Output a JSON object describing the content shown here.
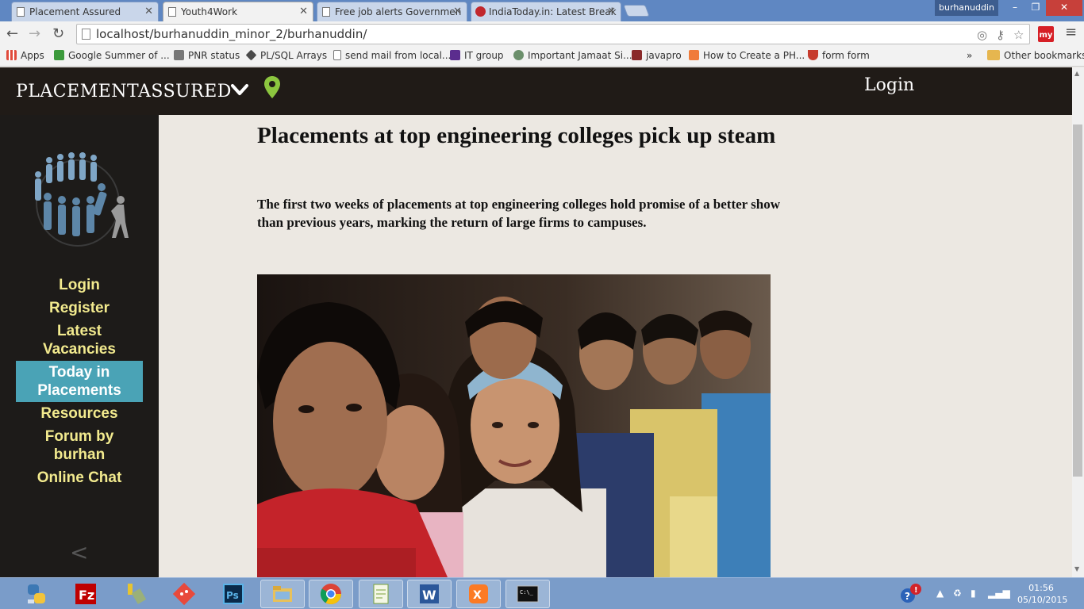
{
  "browser": {
    "tabs": [
      {
        "title": "Placement Assured",
        "active": false
      },
      {
        "title": "Youth4Work",
        "active": true
      },
      {
        "title": "Free job alerts Governmen",
        "active": false
      },
      {
        "title": "IndiaToday.in: Latest Break",
        "active": false
      }
    ],
    "profile": "burhanuddin",
    "url": "localhost/burhanuddin_minor_2/burhanuddin/",
    "extension_label": "my",
    "bookmarks": [
      {
        "label": "Apps",
        "color": "#e04a3b"
      },
      {
        "label": "Google Summer of ...",
        "color": "#3c9a3c"
      },
      {
        "label": "PNR status",
        "color": "#777777"
      },
      {
        "label": "PL/SQL Arrays",
        "color": "#4a4a4a"
      },
      {
        "label": "send mail from local...",
        "color": "#ffffff"
      },
      {
        "label": "IT group",
        "color": "#5b2d8e"
      },
      {
        "label": "Important Jamaat Si...",
        "color": "#6b8f6b"
      },
      {
        "label": "javapro",
        "color": "#8a2a2a"
      },
      {
        "label": "How to Create a PH...",
        "color": "#f07b3a"
      },
      {
        "label": "form form",
        "color": "#c63b2d"
      }
    ],
    "bookmarks_overflow": "»",
    "other_bookmarks": "Other bookmarks"
  },
  "site": {
    "brand_light": "PLACEMENT",
    "brand_bold": "ASSURED",
    "header_login": "Login",
    "nav": [
      {
        "label": "Login",
        "active": false
      },
      {
        "label": "Register",
        "active": false
      },
      {
        "label": "Latest Vacancies",
        "active": false
      },
      {
        "label": "Today in Placements",
        "active": true
      },
      {
        "label": "Resources",
        "active": false
      },
      {
        "label": "Forum by burhan",
        "active": false
      },
      {
        "label": "Online Chat",
        "active": false
      }
    ],
    "collapse_glyph": "<"
  },
  "article": {
    "headline": "Placements at top engineering colleges pick up steam",
    "summary": "The first two weeks of placements at top engineering colleges hold promise of a better show than previous years, marking the return of large firms to campuses."
  },
  "taskbar": {
    "apps": [
      "python",
      "filezilla",
      "tools",
      "git",
      "photoshop",
      "file-explorer",
      "chrome",
      "notepad",
      "word",
      "xampp",
      "command-prompt"
    ],
    "running": [
      "file-explorer",
      "chrome",
      "notepad",
      "word",
      "xampp",
      "command-prompt"
    ],
    "time": "01:56",
    "date": "05/10/2015"
  },
  "colors": {
    "header_bg": "#201b17",
    "sidebar_bg": "#1d1b19",
    "nav_text": "#f2ea8e",
    "nav_active_bg": "#4aa3b6",
    "content_bg": "#ece8e2",
    "pin": "#8cc63f"
  }
}
